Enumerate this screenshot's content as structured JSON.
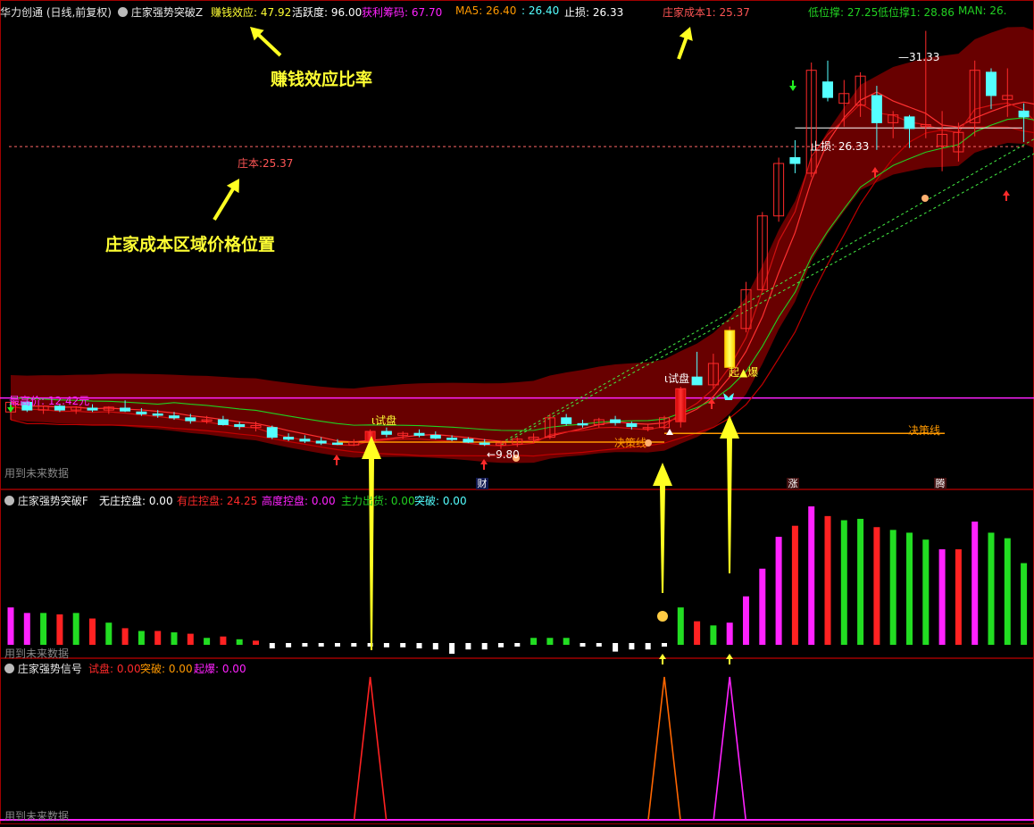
{
  "colors": {
    "bg": "#000000",
    "up": "#ff2a2a",
    "down": "#54ffff",
    "band": "#7a0000",
    "ma5": "#e0e0e0",
    "green_line": "#22d022",
    "orange": "#ff9900",
    "magenta": "#ff22ff",
    "yellow": "#ffff33",
    "white": "#ffffff"
  },
  "main_header": {
    "title": "华力创通 (日线,前复权)",
    "indicator": "庄家强势突破Z",
    "fields": [
      {
        "label": "赚钱效应:",
        "value": "47.92",
        "color": "#ffff33"
      },
      {
        "label": "活跃度:",
        "value": "96.00",
        "color": "#ffffff"
      },
      {
        "label": "获利筹码:",
        "value": "67.70",
        "color": "#ff22ff"
      },
      {
        "label": "MA5:",
        "value": "26.40",
        "color": "#ff9900"
      },
      {
        "label": ":",
        "value": "26.40",
        "color": "#54ffff"
      },
      {
        "label": "止损:",
        "value": "26.33",
        "color": "#ffffff"
      },
      {
        "label": "庄家成本1:",
        "value": "25.37",
        "color": "#ff5555"
      },
      {
        "label": "低位撑:",
        "value": "27.25",
        "color": "#22d022"
      },
      {
        "label": "低位撑1:",
        "value": "28.86",
        "color": "#22d022"
      },
      {
        "label": "MAN:",
        "value": "26.",
        "color": "#22d022"
      }
    ]
  },
  "annotations": {
    "profit_ratio": "赚钱效应比率",
    "cost_position": "庄家成本区域价格位置"
  },
  "main_labels": {
    "cost_line": "庄本:25.37",
    "high_price": "最高价: 12.42元",
    "future_note": "用到未来数据",
    "trial1": "试盘",
    "trial2": "试盘",
    "trial3": "试盘",
    "decision1": "决策线",
    "decision2": "决策线",
    "low_mark": "9.80",
    "high_mark": "31.33",
    "stop_loss": "止损: 26.33",
    "burst": "起▲爆",
    "badge_cai": "财",
    "badge_zhang": "涨",
    "badge_teng": "腾"
  },
  "panel2": {
    "title": "庄家强势突破F",
    "fields": [
      {
        "label": "无庄控盘:",
        "value": "0.00",
        "color": "#ffffff"
      },
      {
        "label": "有庄控盘:",
        "value": "24.25",
        "color": "#ff2a2a"
      },
      {
        "label": "高度控盘:",
        "value": "0.00",
        "color": "#ff22ff"
      },
      {
        "label": "主力出货:",
        "value": "0.00",
        "color": "#22d022"
      },
      {
        "label": "突破:",
        "value": "0.00",
        "color": "#54ffff"
      }
    ],
    "future_note": "用到未来数据"
  },
  "panel3": {
    "title": "庄家强势信号",
    "fields": [
      {
        "label": "试盘:",
        "value": "0.00",
        "color": "#ff2a2a"
      },
      {
        "label": "突破:",
        "value": "0.00",
        "color": "#ff9900"
      },
      {
        "label": "起爆:",
        "value": "0.00",
        "color": "#ff22ff"
      }
    ],
    "future_note": "用到未来数据"
  },
  "chart_data": [
    {
      "type": "candlestick",
      "title": "华力创通 (日线,前复权)",
      "ylim": [
        9.0,
        32.0
      ],
      "reference_lines": {
        "cost": 25.37,
        "highest": 12.42
      },
      "candles": [
        {
          "o": 11.7,
          "h": 12.2,
          "l": 11.3,
          "c": 12.2
        },
        {
          "o": 12.2,
          "h": 12.3,
          "l": 11.7,
          "c": 11.8
        },
        {
          "o": 11.8,
          "h": 12.0,
          "l": 11.6,
          "c": 12.0
        },
        {
          "o": 12.0,
          "h": 12.1,
          "l": 11.7,
          "c": 11.8
        },
        {
          "o": 11.8,
          "h": 12.0,
          "l": 11.6,
          "c": 11.95
        },
        {
          "o": 11.9,
          "h": 12.1,
          "l": 11.7,
          "c": 11.8
        },
        {
          "o": 11.8,
          "h": 12.0,
          "l": 11.6,
          "c": 11.95
        },
        {
          "o": 11.9,
          "h": 12.3,
          "l": 11.7,
          "c": 11.75
        },
        {
          "o": 11.7,
          "h": 11.9,
          "l": 11.5,
          "c": 11.6
        },
        {
          "o": 11.6,
          "h": 11.8,
          "l": 11.4,
          "c": 11.55
        },
        {
          "o": 11.5,
          "h": 11.7,
          "l": 11.3,
          "c": 11.4
        },
        {
          "o": 11.4,
          "h": 11.6,
          "l": 11.1,
          "c": 11.25
        },
        {
          "o": 11.25,
          "h": 11.5,
          "l": 11.1,
          "c": 11.3
        },
        {
          "o": 11.3,
          "h": 11.5,
          "l": 11.0,
          "c": 11.05
        },
        {
          "o": 11.05,
          "h": 11.2,
          "l": 10.8,
          "c": 10.95
        },
        {
          "o": 10.9,
          "h": 11.2,
          "l": 10.7,
          "c": 11.0
        },
        {
          "o": 10.9,
          "h": 11.0,
          "l": 10.3,
          "c": 10.4
        },
        {
          "o": 10.4,
          "h": 10.6,
          "l": 10.2,
          "c": 10.3
        },
        {
          "o": 10.3,
          "h": 10.5,
          "l": 10.1,
          "c": 10.2
        },
        {
          "o": 10.2,
          "h": 10.4,
          "l": 10.0,
          "c": 10.1
        },
        {
          "o": 10.1,
          "h": 10.3,
          "l": 10.0,
          "c": 10.05
        },
        {
          "o": 10.0,
          "h": 10.3,
          "l": 9.95,
          "c": 10.15
        },
        {
          "o": 10.2,
          "h": 10.8,
          "l": 10.1,
          "c": 10.7
        },
        {
          "o": 10.7,
          "h": 10.9,
          "l": 10.4,
          "c": 10.55
        },
        {
          "o": 10.5,
          "h": 10.7,
          "l": 10.3,
          "c": 10.6
        },
        {
          "o": 10.6,
          "h": 10.8,
          "l": 10.4,
          "c": 10.5
        },
        {
          "o": 10.5,
          "h": 10.7,
          "l": 10.3,
          "c": 10.35
        },
        {
          "o": 10.35,
          "h": 10.5,
          "l": 10.2,
          "c": 10.3
        },
        {
          "o": 10.3,
          "h": 10.4,
          "l": 10.1,
          "c": 10.15
        },
        {
          "o": 10.1,
          "h": 10.3,
          "l": 9.95,
          "c": 10.05
        },
        {
          "o": 10.0,
          "h": 10.2,
          "l": 9.8,
          "c": 10.1
        },
        {
          "o": 10.05,
          "h": 10.4,
          "l": 9.9,
          "c": 10.3
        },
        {
          "o": 10.3,
          "h": 10.6,
          "l": 10.1,
          "c": 10.4
        },
        {
          "o": 10.4,
          "h": 11.6,
          "l": 10.3,
          "c": 11.4
        },
        {
          "o": 11.4,
          "h": 11.6,
          "l": 11.0,
          "c": 11.1
        },
        {
          "o": 11.1,
          "h": 11.3,
          "l": 10.9,
          "c": 11.05
        },
        {
          "o": 11.05,
          "h": 11.4,
          "l": 10.9,
          "c": 11.3
        },
        {
          "o": 11.3,
          "h": 11.5,
          "l": 11.0,
          "c": 11.15
        },
        {
          "o": 11.1,
          "h": 11.2,
          "l": 10.8,
          "c": 10.95
        },
        {
          "o": 10.9,
          "h": 11.1,
          "l": 10.7,
          "c": 10.9
        },
        {
          "o": 10.9,
          "h": 11.5,
          "l": 10.8,
          "c": 11.4
        },
        {
          "o": 11.2,
          "h": 13.0,
          "l": 10.9,
          "c": 12.9
        },
        {
          "o": 13.5,
          "h": 14.8,
          "l": 13.3,
          "c": 13.1
        },
        {
          "o": 13.1,
          "h": 14.7,
          "l": 12.9,
          "c": 14.2
        },
        {
          "o": 14.0,
          "h": 16.1,
          "l": 13.9,
          "c": 15.9
        },
        {
          "o": 16.0,
          "h": 18.4,
          "l": 15.8,
          "c": 18.0
        },
        {
          "o": 18.0,
          "h": 22.0,
          "l": 17.9,
          "c": 21.8
        },
        {
          "o": 21.8,
          "h": 24.8,
          "l": 21.5,
          "c": 24.5
        },
        {
          "o": 24.8,
          "h": 25.7,
          "l": 24.0,
          "c": 24.5
        },
        {
          "o": 24.0,
          "h": 29.7,
          "l": 23.8,
          "c": 29.3
        },
        {
          "o": 28.7,
          "h": 29.8,
          "l": 27.7,
          "c": 27.9
        },
        {
          "o": 27.6,
          "h": 28.8,
          "l": 26.4,
          "c": 28.1
        },
        {
          "o": 27.5,
          "h": 29.2,
          "l": 26.9,
          "c": 29.0
        },
        {
          "o": 28.0,
          "h": 28.5,
          "l": 25.2,
          "c": 26.6
        },
        {
          "o": 26.6,
          "h": 27.2,
          "l": 25.8,
          "c": 27.0
        },
        {
          "o": 26.9,
          "h": 27.0,
          "l": 25.3,
          "c": 26.3
        },
        {
          "o": 26.4,
          "h": 31.33,
          "l": 25.8,
          "c": 26.5
        },
        {
          "o": 25.4,
          "h": 27.2,
          "l": 24.1,
          "c": 26.0
        },
        {
          "o": 25.1,
          "h": 26.6,
          "l": 24.6,
          "c": 26.1
        },
        {
          "o": 26.6,
          "h": 29.8,
          "l": 25.9,
          "c": 29.3
        },
        {
          "o": 29.2,
          "h": 29.4,
          "l": 27.3,
          "c": 28.0
        },
        {
          "o": 27.8,
          "h": 29.4,
          "l": 26.9,
          "c": 28.0
        },
        {
          "o": 27.2,
          "h": 27.6,
          "l": 25.6,
          "c": 26.9
        },
        {
          "o": 26.9,
          "h": 28.3,
          "l": 24.8,
          "c": 25.3
        },
        {
          "o": 25.3,
          "h": 26.0,
          "l": 24.6,
          "c": 25.1
        },
        {
          "o": 25.1,
          "h": 27.8,
          "l": 24.9,
          "c": 27.2
        }
      ]
    },
    {
      "type": "bar",
      "title": "庄家强势突破F",
      "ylim": [
        0,
        100
      ],
      "values": [
        27,
        23,
        23,
        22,
        23,
        19,
        16,
        12,
        10,
        10,
        9,
        8,
        5,
        6,
        4,
        3,
        -5,
        -4,
        -3,
        -2,
        -1,
        -2,
        -3,
        -4,
        -4,
        -5,
        -6,
        -10,
        -6,
        -6,
        -4,
        -2,
        5,
        5,
        5,
        -2,
        -3,
        -8,
        -6,
        -6,
        -3,
        27,
        17,
        14,
        16,
        35,
        55,
        78,
        86,
        100,
        93,
        90,
        91,
        85,
        83,
        81,
        76,
        69,
        69,
        89,
        81,
        77,
        59,
        57,
        56,
        66
      ]
    },
    {
      "type": "line",
      "title": "庄家强势信号",
      "series": [
        {
          "name": "试盘",
          "spikes_at": [
            22
          ]
        },
        {
          "name": "突破",
          "spikes_at": [
            40
          ]
        },
        {
          "name": "起爆",
          "spikes_at": [
            44
          ]
        }
      ]
    }
  ]
}
